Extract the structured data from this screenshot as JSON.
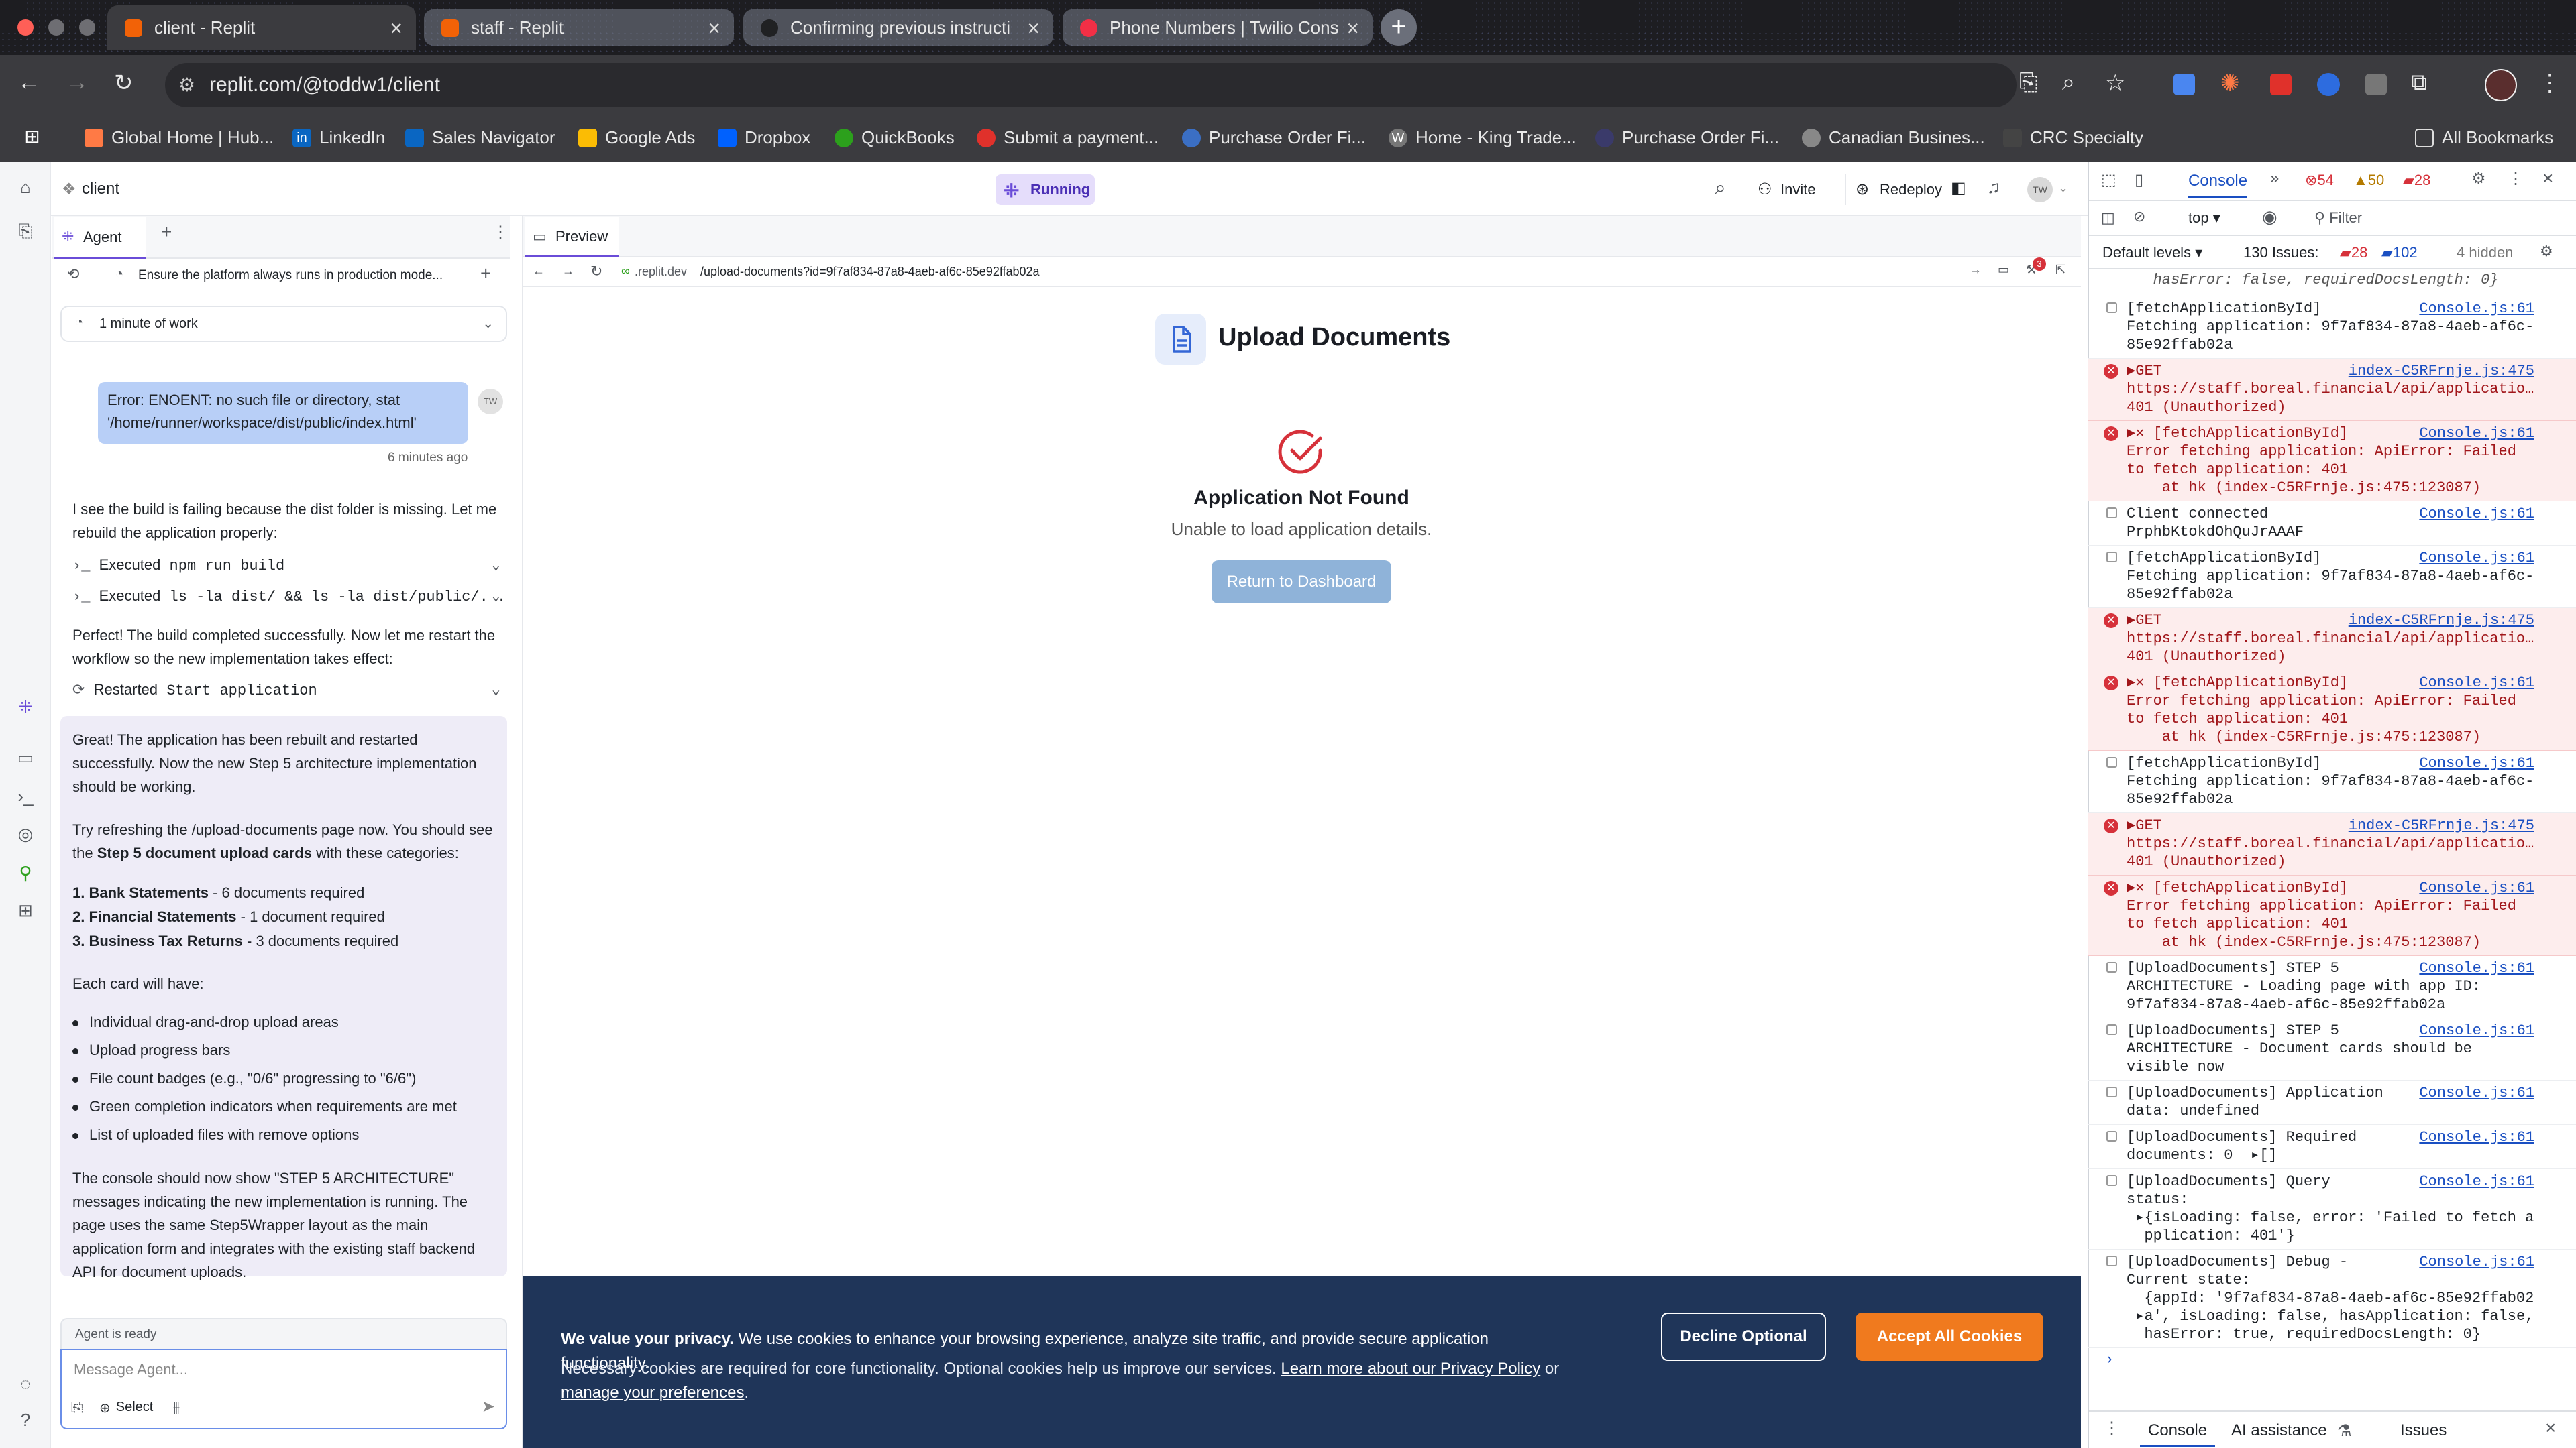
{
  "browser": {
    "tabs": [
      {
        "title": "client - Replit",
        "active": true
      },
      {
        "title": "staff - Replit",
        "active": false
      },
      {
        "title": "Confirming previous instructi",
        "active": false
      },
      {
        "title": "Phone Numbers | Twilio Cons",
        "active": false
      }
    ],
    "url": "replit.com/@toddw1/client",
    "bookmarks": [
      "Global Home | Hub...",
      "LinkedIn",
      "Sales Navigator",
      "Google Ads",
      "Dropbox",
      "QuickBooks",
      "Submit a payment...",
      "Purchase Order Fi...",
      "Home - King Trade...",
      "Purchase Order Fi...",
      "Canadian Busines...",
      "CRC Specialty"
    ],
    "all_bookmarks": "All Bookmarks"
  },
  "app": {
    "project": "client",
    "status": "Running",
    "invite": "Invite",
    "redeploy": "Redeploy",
    "avatar": "TW"
  },
  "agent": {
    "tab": "Agent",
    "checkpoint": "Ensure the platform always runs in production mode...",
    "work": "1 minute of work",
    "user_msg": "Error: ENOENT: no such file or directory, stat '/home/runner/workspace/dist/public/index.html'",
    "user_avatar": "TW",
    "user_time": "6 minutes ago",
    "msg1": "I see the build is failing because the dist folder is missing. Let me rebuild the application properly:",
    "cmd1_prefix": "Executed",
    "cmd1": "npm run build",
    "cmd2_prefix": "Executed",
    "cmd2": "ls -la dist/ && ls -la dist/public/...",
    "msg2": "Perfect! The build completed successfully. Now let me restart the workflow so the new implementation takes effect:",
    "cmd3_prefix": "Restarted",
    "cmd3": "Start application",
    "final": {
      "p1": "Great! The application has been rebuilt and restarted successfully. Now the new Step 5 architecture implementation should be working.",
      "p2a": "Try refreshing the /upload-documents page now. You should see the ",
      "p2b": "Step 5 document upload cards",
      "p2c": " with these categories:",
      "cats": [
        {
          "name": "1. Bank Statements",
          "detail": " - 6 documents required"
        },
        {
          "name": "2. Financial Statements",
          "detail": " - 1 document required"
        },
        {
          "name": "3. Business Tax Returns",
          "detail": " - 3 documents required"
        }
      ],
      "p3": "Each card will have:",
      "bullets": [
        "Individual drag-and-drop upload areas",
        "Upload progress bars",
        "File count badges (e.g., \"0/6\" progressing to \"6/6\")",
        "Green completion indicators when requirements are met",
        "List of uploaded files with remove options"
      ],
      "p4": "The console should now show \"STEP 5 ARCHITECTURE\" messages indicating the new implementation is running. The page uses the same Step5Wrapper layout as the main application form and integrates with the existing staff backend API for document uploads."
    },
    "status": "Agent is ready",
    "placeholder": "Message Agent...",
    "select": "Select"
  },
  "preview": {
    "tab": "Preview",
    "url_prefix": ".replit.dev",
    "url_path": "/upload-documents?id=9f7af834-87a8-4aeb-af6c-85e92ffab02a",
    "notif_count": "3",
    "title": "Upload Documents",
    "heading": "Application Not Found",
    "sub": "Unable to load application details.",
    "button": "Return to Dashboard"
  },
  "cookie": {
    "bold": "We value your privacy.",
    "text1": " We use cookies to enhance your browsing experience, analyze site traffic, and provide secure application functionality.",
    "text2": "Necessary cookies are required for core functionality. Optional cookies help us improve our services. ",
    "link1": "Learn more about our Privacy Policy",
    "or": " or",
    "link2": "manage your preferences",
    "period": ".",
    "decline": "Decline Optional",
    "accept": "Accept All Cookies"
  },
  "devtools": {
    "tab": "Console",
    "errors": "54",
    "warnings": "50",
    "issues_badge": "28",
    "context": "top",
    "filter": "Filter",
    "levels": "Default levels",
    "issues": "130 Issues:",
    "issues_err": "28",
    "issues_info": "102",
    "hidden": "4 hidden",
    "top_partial": "   hasError: false, requiredDocsLength: 0}",
    "rows": [
      {
        "type": "log",
        "text": "[fetchApplicationById]\nFetching application: 9f7af834-87a8-4aeb-af6c-\n85e92ffab02a",
        "src": "Console.js:61"
      },
      {
        "type": "err",
        "text": "▶GET\nhttps://staff.boreal.financial/api/applicatio…\n401 (Unauthorized)",
        "src": "index-C5RFrnje.js:475"
      },
      {
        "type": "err",
        "text": "▶✕ [fetchApplicationById]\nError fetching application: ApiError: Failed\nto fetch application: 401\n    at hk (index-C5RFrnje.js:475:123087)",
        "src": "Console.js:61"
      },
      {
        "type": "log",
        "text": "Client connected\nPrphbKtokdOhQuJrAAAF",
        "src": "Console.js:61"
      },
      {
        "type": "log",
        "text": "[fetchApplicationById]\nFetching application: 9f7af834-87a8-4aeb-af6c-\n85e92ffab02a",
        "src": "Console.js:61"
      },
      {
        "type": "err",
        "text": "▶GET\nhttps://staff.boreal.financial/api/applicatio…\n401 (Unauthorized)",
        "src": "index-C5RFrnje.js:475"
      },
      {
        "type": "err",
        "text": "▶✕ [fetchApplicationById]\nError fetching application: ApiError: Failed\nto fetch application: 401\n    at hk (index-C5RFrnje.js:475:123087)",
        "src": "Console.js:61"
      },
      {
        "type": "log",
        "text": "[fetchApplicationById]\nFetching application: 9f7af834-87a8-4aeb-af6c-\n85e92ffab02a",
        "src": "Console.js:61"
      },
      {
        "type": "err",
        "text": "▶GET\nhttps://staff.boreal.financial/api/applicatio…\n401 (Unauthorized)",
        "src": "index-C5RFrnje.js:475"
      },
      {
        "type": "err",
        "text": "▶✕ [fetchApplicationById]\nError fetching application: ApiError: Failed\nto fetch application: 401\n    at hk (index-C5RFrnje.js:475:123087)",
        "src": "Console.js:61"
      },
      {
        "type": "log",
        "text": "[UploadDocuments] STEP 5\nARCHITECTURE - Loading page with app ID:\n9f7af834-87a8-4aeb-af6c-85e92ffab02a",
        "src": "Console.js:61"
      },
      {
        "type": "log",
        "text": "[UploadDocuments] STEP 5\nARCHITECTURE - Document cards should be\nvisible now",
        "src": "Console.js:61"
      },
      {
        "type": "log",
        "text": "[UploadDocuments] Application\ndata: undefined",
        "src": "Console.js:61"
      },
      {
        "type": "log",
        "text": "[UploadDocuments] Required\ndocuments: 0  ▸[]",
        "src": "Console.js:61"
      },
      {
        "type": "log",
        "text": "[UploadDocuments] Query\nstatus:\n ▸{isLoading: false, error: 'Failed to fetch a\n  pplication: 401'}",
        "src": "Console.js:61"
      },
      {
        "type": "log",
        "text": "[UploadDocuments] Debug -\nCurrent state:\n  {appId: '9f7af834-87a8-4aeb-af6c-85e92ffab02\n ▸a', isLoading: false, hasApplication: false,\n  hasError: true, requiredDocsLength: 0}",
        "src": "Console.js:61"
      }
    ],
    "drawer_tabs": [
      "Console",
      "AI assistance",
      "Issues"
    ]
  }
}
